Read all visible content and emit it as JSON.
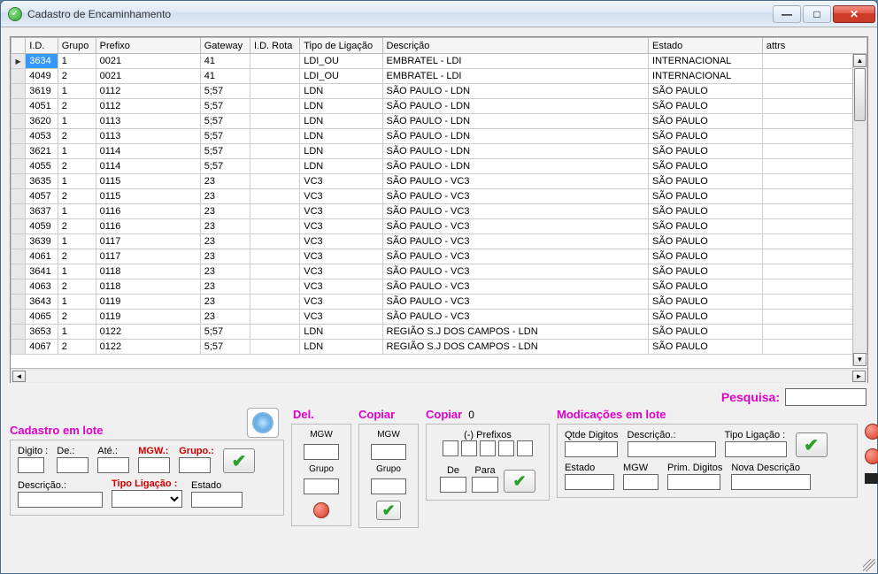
{
  "window": {
    "title": "Cadastro de Encaminhamento"
  },
  "grid": {
    "columns": [
      "I.D.",
      "Grupo",
      "Prefixo",
      "Gateway",
      "I.D. Rota",
      "Tipo de Ligação",
      "Descrição",
      "Estado",
      "attrs"
    ],
    "rows": [
      {
        "id": "3634",
        "grupo": "1",
        "prefixo": "0021",
        "gateway": "41",
        "idrota": "",
        "tipo": "LDI_OU",
        "desc": "EMBRATEL - LDI",
        "estado": "INTERNACIONAL",
        "attrs": ""
      },
      {
        "id": "4049",
        "grupo": "2",
        "prefixo": "0021",
        "gateway": "41",
        "idrota": "",
        "tipo": "LDI_OU",
        "desc": "EMBRATEL - LDI",
        "estado": "INTERNACIONAL",
        "attrs": ""
      },
      {
        "id": "3619",
        "grupo": "1",
        "prefixo": "0112",
        "gateway": "5;57",
        "idrota": "",
        "tipo": "LDN",
        "desc": "SÃO PAULO - LDN",
        "estado": "SÃO PAULO",
        "attrs": ""
      },
      {
        "id": "4051",
        "grupo": "2",
        "prefixo": "0112",
        "gateway": "5;57",
        "idrota": "",
        "tipo": "LDN",
        "desc": "SÃO PAULO - LDN",
        "estado": "SÃO PAULO",
        "attrs": ""
      },
      {
        "id": "3620",
        "grupo": "1",
        "prefixo": "0113",
        "gateway": "5;57",
        "idrota": "",
        "tipo": "LDN",
        "desc": "SÃO PAULO - LDN",
        "estado": "SÃO PAULO",
        "attrs": ""
      },
      {
        "id": "4053",
        "grupo": "2",
        "prefixo": "0113",
        "gateway": "5;57",
        "idrota": "",
        "tipo": "LDN",
        "desc": "SÃO PAULO - LDN",
        "estado": "SÃO PAULO",
        "attrs": ""
      },
      {
        "id": "3621",
        "grupo": "1",
        "prefixo": "0114",
        "gateway": "5;57",
        "idrota": "",
        "tipo": "LDN",
        "desc": "SÃO PAULO - LDN",
        "estado": "SÃO PAULO",
        "attrs": ""
      },
      {
        "id": "4055",
        "grupo": "2",
        "prefixo": "0114",
        "gateway": "5;57",
        "idrota": "",
        "tipo": "LDN",
        "desc": "SÃO PAULO - LDN",
        "estado": "SÃO PAULO",
        "attrs": ""
      },
      {
        "id": "3635",
        "grupo": "1",
        "prefixo": "0115",
        "gateway": "23",
        "idrota": "",
        "tipo": "VC3",
        "desc": "SÃO PAULO - VC3",
        "estado": "SÃO PAULO",
        "attrs": ""
      },
      {
        "id": "4057",
        "grupo": "2",
        "prefixo": "0115",
        "gateway": "23",
        "idrota": "",
        "tipo": "VC3",
        "desc": "SÃO PAULO - VC3",
        "estado": "SÃO PAULO",
        "attrs": ""
      },
      {
        "id": "3637",
        "grupo": "1",
        "prefixo": "0116",
        "gateway": "23",
        "idrota": "",
        "tipo": "VC3",
        "desc": "SÃO PAULO - VC3",
        "estado": "SÃO PAULO",
        "attrs": ""
      },
      {
        "id": "4059",
        "grupo": "2",
        "prefixo": "0116",
        "gateway": "23",
        "idrota": "",
        "tipo": "VC3",
        "desc": "SÃO PAULO - VC3",
        "estado": "SÃO PAULO",
        "attrs": ""
      },
      {
        "id": "3639",
        "grupo": "1",
        "prefixo": "0117",
        "gateway": "23",
        "idrota": "",
        "tipo": "VC3",
        "desc": "SÃO PAULO - VC3",
        "estado": "SÃO PAULO",
        "attrs": ""
      },
      {
        "id": "4061",
        "grupo": "2",
        "prefixo": "0117",
        "gateway": "23",
        "idrota": "",
        "tipo": "VC3",
        "desc": "SÃO PAULO - VC3",
        "estado": "SÃO PAULO",
        "attrs": ""
      },
      {
        "id": "3641",
        "grupo": "1",
        "prefixo": "0118",
        "gateway": "23",
        "idrota": "",
        "tipo": "VC3",
        "desc": "SÃO PAULO - VC3",
        "estado": "SÃO PAULO",
        "attrs": ""
      },
      {
        "id": "4063",
        "grupo": "2",
        "prefixo": "0118",
        "gateway": "23",
        "idrota": "",
        "tipo": "VC3",
        "desc": "SÃO PAULO - VC3",
        "estado": "SÃO PAULO",
        "attrs": ""
      },
      {
        "id": "3643",
        "grupo": "1",
        "prefixo": "0119",
        "gateway": "23",
        "idrota": "",
        "tipo": "VC3",
        "desc": "SÃO PAULO - VC3",
        "estado": "SÃO PAULO",
        "attrs": ""
      },
      {
        "id": "4065",
        "grupo": "2",
        "prefixo": "0119",
        "gateway": "23",
        "idrota": "",
        "tipo": "VC3",
        "desc": "SÃO PAULO - VC3",
        "estado": "SÃO PAULO",
        "attrs": ""
      },
      {
        "id": "3653",
        "grupo": "1",
        "prefixo": "0122",
        "gateway": "5;57",
        "idrota": "",
        "tipo": "LDN",
        "desc": "REGIÃO S.J DOS CAMPOS - LDN",
        "estado": "SÃO PAULO",
        "attrs": ""
      },
      {
        "id": "4067",
        "grupo": "2",
        "prefixo": "0122",
        "gateway": "5;57",
        "idrota": "",
        "tipo": "LDN",
        "desc": "REGIÃO S.J DOS CAMPOS - LDN",
        "estado": "SÃO PAULO",
        "attrs": ""
      }
    ]
  },
  "search": {
    "label": "Pesquisa:"
  },
  "sections": {
    "cadastro": "Cadastro em lote",
    "del": "Del.",
    "copiar1": "Copiar",
    "copiar2": "Copiar",
    "copiar_count": "0",
    "mod": "Modicações em lote"
  },
  "cadastro": {
    "digito": "Digito :",
    "de": "De.:",
    "ate": "Até.:",
    "mgw": "MGW.:",
    "grupo": "Grupo.:",
    "descricao": "Descrição.:",
    "tipoligacao": "Tipo Ligação :",
    "estado": "Estado"
  },
  "del": {
    "mgw": "MGW",
    "grupo": "Grupo"
  },
  "copiar_mini": {
    "mgw": "MGW",
    "grupo": "Grupo"
  },
  "copiar": {
    "prefixos": "(-) Prefixos",
    "de": "De",
    "para": "Para"
  },
  "mod": {
    "qtde": "Qtde Digitos",
    "descricao": "Descrição.:",
    "tipoligacao": "Tipo Ligação :",
    "estado": "Estado",
    "mgw": "MGW",
    "primdig": "Prim. Digitos",
    "novadesc": "Nova Descrição"
  }
}
